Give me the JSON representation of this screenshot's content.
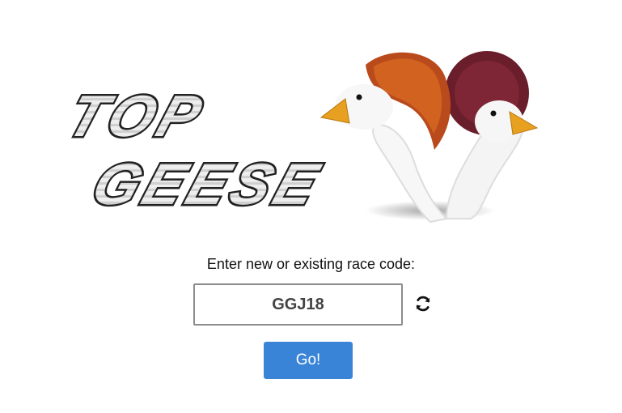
{
  "logo": {
    "line1": "TOP",
    "line2": "GEESE"
  },
  "form": {
    "prompt": "Enter new or existing race code:",
    "code_value": "GGJ18",
    "go_label": "Go!"
  },
  "icons": {
    "refresh": "refresh-icon"
  },
  "colors": {
    "button_bg": "#3a84d8",
    "button_text": "#ffffff",
    "input_border": "#8c8c8c",
    "input_text": "#444444"
  }
}
